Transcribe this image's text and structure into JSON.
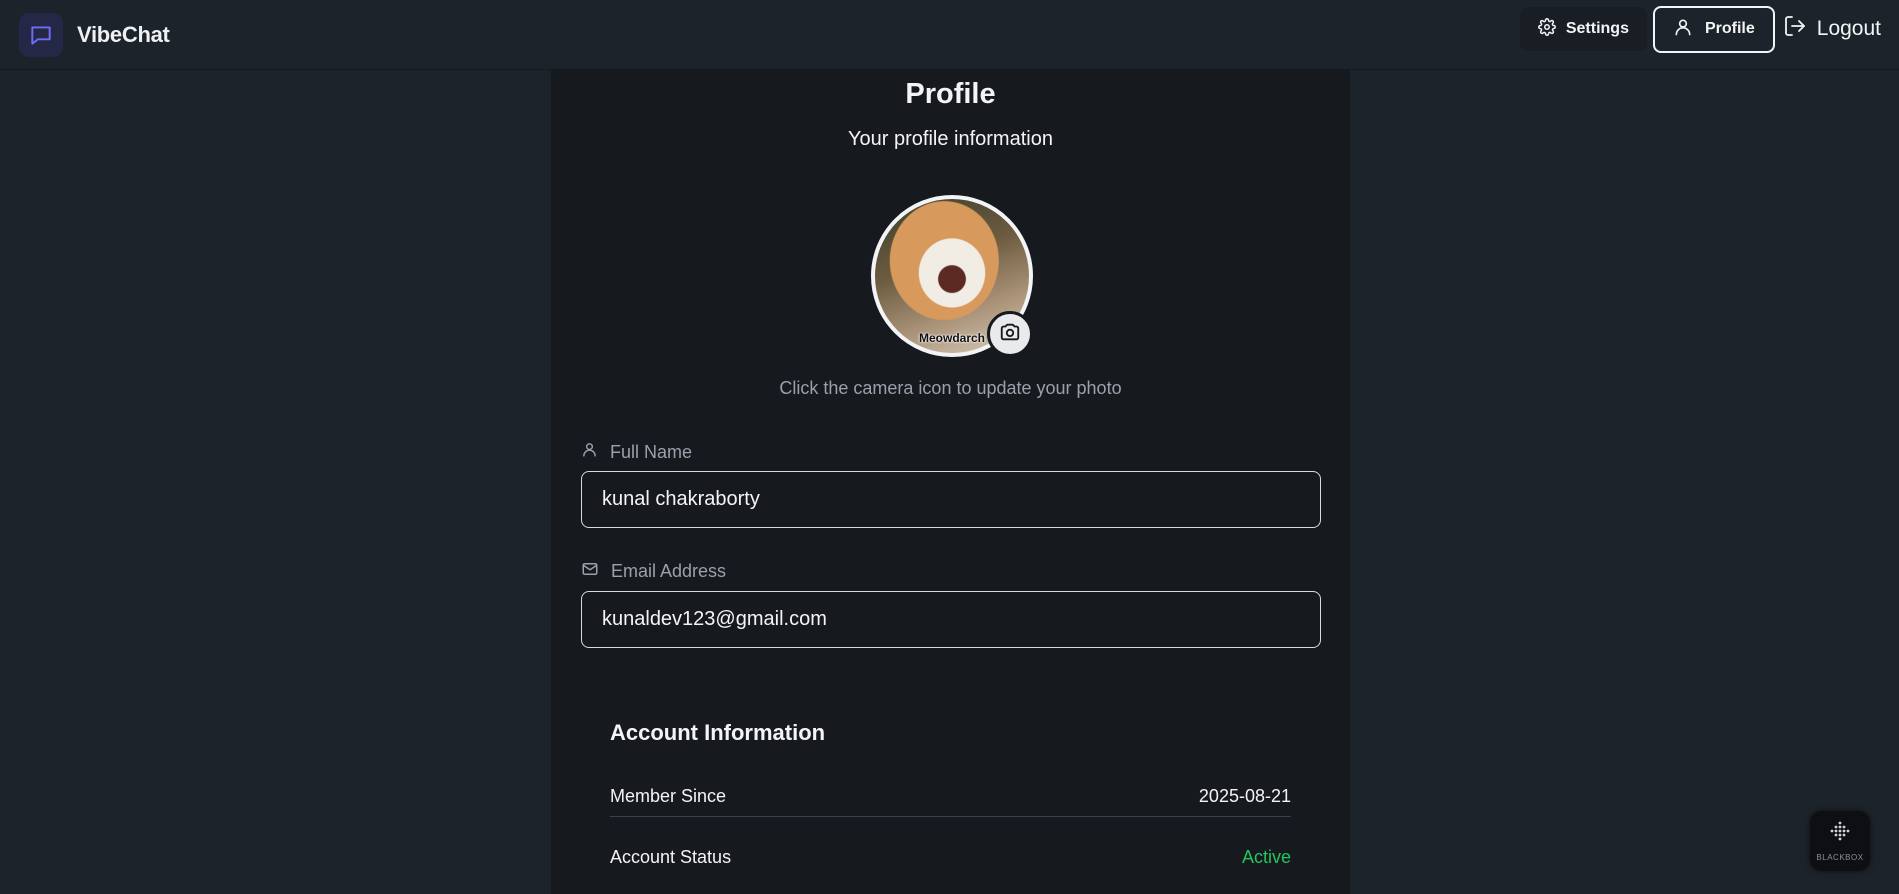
{
  "navbar": {
    "brand": "VibeChat",
    "settings_label": "Settings",
    "profile_label": "Profile",
    "logout_label": "Logout"
  },
  "profile": {
    "title": "Profile",
    "subtitle": "Your profile information",
    "avatar_caption": "Meowdarch",
    "photo_hint": "Click the camera icon to update your photo",
    "full_name_label": "Full Name",
    "full_name_value": "kunal chakraborty",
    "email_label": "Email Address",
    "email_value": "kunaldev123@gmail.com"
  },
  "account": {
    "title": "Account Information",
    "rows": [
      {
        "label": "Member Since",
        "value": "2025-08-21"
      },
      {
        "label": "Account Status",
        "value": "Active"
      }
    ]
  },
  "widget": {
    "label": "BLACKBOX"
  },
  "colors": {
    "background": "#1d232a",
    "card": "#16191e",
    "accent": "#6366f1",
    "status_active": "#22c55e"
  }
}
